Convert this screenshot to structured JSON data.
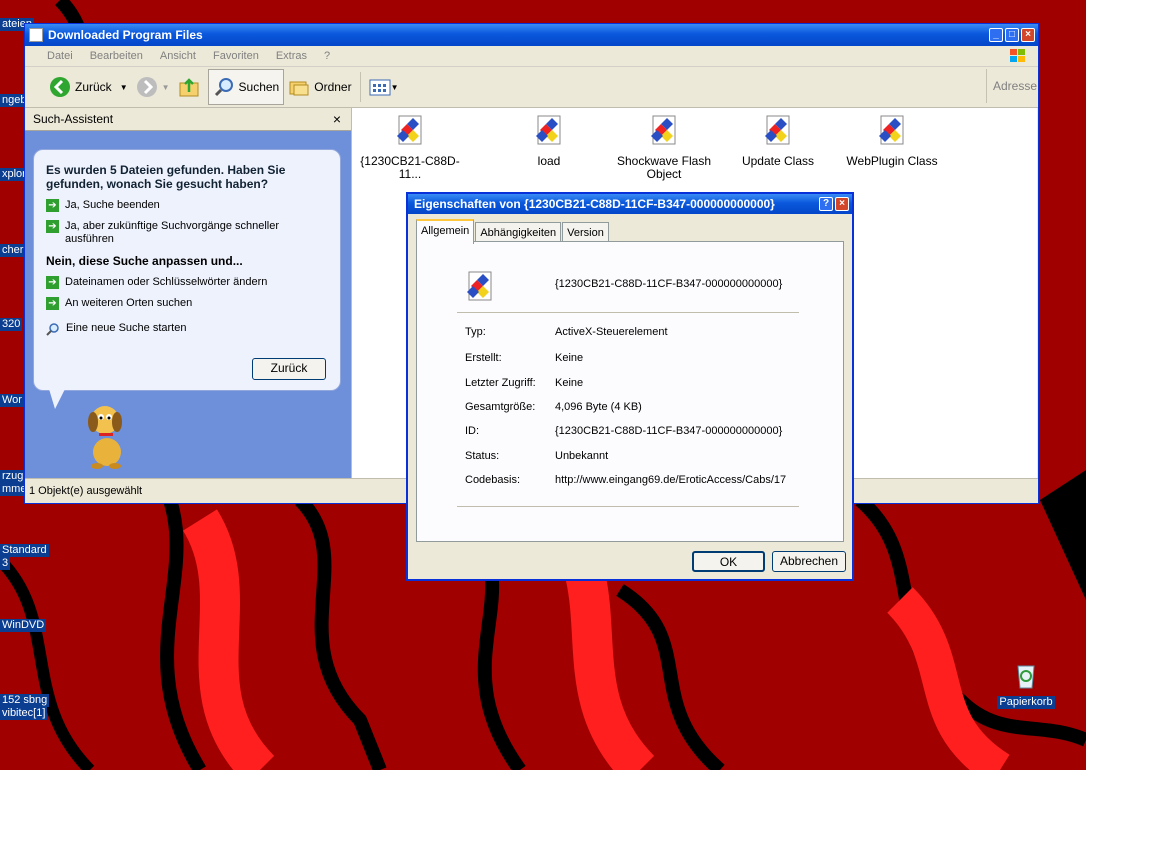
{
  "desktop": {
    "icons": [
      {
        "label": "ateien",
        "icon": "folder-icon"
      },
      {
        "label": "ngebu",
        "icon": "app-icon"
      },
      {
        "label": "xplore",
        "icon": "ie-icon"
      },
      {
        "label": "cher",
        "icon": "app-icon"
      },
      {
        "label": "320",
        "icon": "app-icon"
      },
      {
        "label": "Wor",
        "icon": "word-icon"
      },
      {
        "label": "rzug",
        "icon": "app-icon"
      },
      {
        "label": "mme",
        "icon": "app-icon"
      },
      {
        "label": "Standard",
        "icon": "app-icon"
      },
      {
        "label": "3",
        "icon": "app-icon"
      },
      {
        "label": "WinDVD",
        "icon": "dvd-icon"
      },
      {
        "label": "152 sbng",
        "icon": "file-icon"
      },
      {
        "label": "vibitec[1]",
        "icon": "file-icon"
      }
    ],
    "recycle_bin": {
      "label": "Papierkorb",
      "icon": "recycle-bin-icon"
    }
  },
  "explorer": {
    "title": "Downloaded Program Files",
    "menu": [
      "Datei",
      "Bearbeiten",
      "Ansicht",
      "Favoriten",
      "Extras",
      "?"
    ],
    "toolbar": {
      "back": "Zurück",
      "search": "Suchen",
      "folders": "Ordner",
      "address": "Adresse"
    },
    "search_pane": {
      "header": "Such-Assistent",
      "close": "×",
      "question": "Es wurden 5 Dateien gefunden. Haben Sie gefunden, wonach Sie gesucht haben?",
      "yes_options": [
        "Ja, Suche beenden",
        "Ja, aber zukünftige Suchvorgänge schneller ausführen"
      ],
      "no_heading": "Nein, diese Suche anpassen und...",
      "no_options": [
        "Dateinamen oder Schlüsselwörter ändern",
        "An weiteren Orten suchen"
      ],
      "new_search": "Eine neue Suche starten",
      "back_button": "Zurück"
    },
    "files": [
      {
        "name": "{1230CB21-C88D-11..."
      },
      {
        "name": "load"
      },
      {
        "name": "Shockwave Flash Object"
      },
      {
        "name": "Update Class"
      },
      {
        "name": "WebPlugin Class"
      }
    ],
    "status": "1 Objekt(e) ausgewählt"
  },
  "dialog": {
    "title": "Eigenschaften von {1230CB21-C88D-11CF-B347-000000000000}",
    "help": "?",
    "close": "×",
    "tabs": [
      "Allgemein",
      "Abhängigkeiten",
      "Version"
    ],
    "object_name": "{1230CB21-C88D-11CF-B347-000000000000}",
    "props": [
      {
        "label": "Typ:",
        "value": "ActiveX-Steuerelement"
      },
      {
        "label": "Erstellt:",
        "value": "Keine"
      },
      {
        "label": "Letzter Zugriff:",
        "value": "Keine"
      },
      {
        "label": "Gesamtgröße:",
        "value": "4,096 Byte  (4 KB)"
      },
      {
        "label": "ID:",
        "value": "{1230CB21-C88D-11CF-B347-000000000000}"
      },
      {
        "label": "Status:",
        "value": "Unbekannt"
      },
      {
        "label": "Codebasis:",
        "value": "http://www.eingang69.de/EroticAccess/Cabs/17"
      }
    ],
    "ok": "OK",
    "cancel": "Abbrechen"
  }
}
